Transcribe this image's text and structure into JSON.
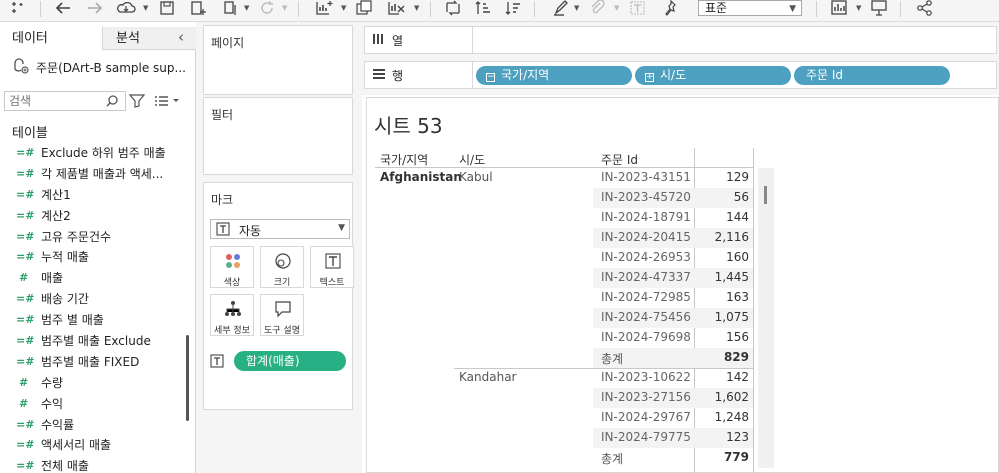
{
  "toolbar": {
    "zoom_value": "표준"
  },
  "data_pane": {
    "tab_data": "데이터",
    "tab_analysis": "분석",
    "datasource": "주문(DArt-B sample sup...",
    "search_placeholder": "검색",
    "tables_heading": "테이블",
    "fields": [
      {
        "icon": "=#",
        "label": "Exclude 하위 범주 매출"
      },
      {
        "icon": "=#",
        "label": "각 제품별 매출과 액세..."
      },
      {
        "icon": "=#",
        "label": "계산1"
      },
      {
        "icon": "=#",
        "label": "계산2"
      },
      {
        "icon": "=#",
        "label": "고유 주문건수"
      },
      {
        "icon": "=#",
        "label": "누적 매출"
      },
      {
        "icon": "#",
        "label": "매출"
      },
      {
        "icon": "=#",
        "label": "배송 기간"
      },
      {
        "icon": "=#",
        "label": "범주 별 매출"
      },
      {
        "icon": "=#",
        "label": "범주별 매출 Exclude"
      },
      {
        "icon": "=#",
        "label": "범주별 매출 FIXED"
      },
      {
        "icon": "#",
        "label": "수량"
      },
      {
        "icon": "#",
        "label": "수익"
      },
      {
        "icon": "=#",
        "label": "수익률"
      },
      {
        "icon": "=#",
        "label": "액세서리 매출"
      },
      {
        "icon": "=#",
        "label": "전체 매출"
      }
    ]
  },
  "cards": {
    "pages_title": "페이지",
    "filters_title": "필터",
    "marks_title": "마크",
    "marks_type": "자동",
    "mark_buttons": {
      "color": "색상",
      "size": "크기",
      "text": "텍스트",
      "detail": "세부 정보",
      "tooltip": "도구 설명"
    },
    "text_pill": "합계(매출)"
  },
  "shelves": {
    "columns_label": "열",
    "rows_label": "행",
    "row_pills": [
      "국가/지역",
      "시/도",
      "주문 Id"
    ]
  },
  "view": {
    "sheet_title": "시트 53",
    "headers": {
      "country": "국가/지역",
      "city": "시/도",
      "order_id": "주문 Id"
    },
    "country": "Afghanistan",
    "cities": [
      {
        "name": "Kabul",
        "rows": [
          {
            "id": "IN-2023-43151",
            "value": "129"
          },
          {
            "id": "IN-2023-45720",
            "value": "56"
          },
          {
            "id": "IN-2024-18791",
            "value": "144"
          },
          {
            "id": "IN-2024-20415",
            "value": "2,116"
          },
          {
            "id": "IN-2024-26953",
            "value": "160"
          },
          {
            "id": "IN-2024-47337",
            "value": "1,445"
          },
          {
            "id": "IN-2024-72985",
            "value": "163"
          },
          {
            "id": "IN-2024-75456",
            "value": "1,075"
          },
          {
            "id": "IN-2024-79698",
            "value": "156"
          }
        ],
        "total_label": "총계",
        "total_value": "829"
      },
      {
        "name": "Kandahar",
        "rows": [
          {
            "id": "IN-2023-10622",
            "value": "142"
          },
          {
            "id": "IN-2023-27156",
            "value": "1,602"
          },
          {
            "id": "IN-2024-29767",
            "value": "1,248"
          },
          {
            "id": "IN-2024-79775",
            "value": "123"
          }
        ],
        "total_label": "총계",
        "total_value": "779"
      }
    ]
  }
}
